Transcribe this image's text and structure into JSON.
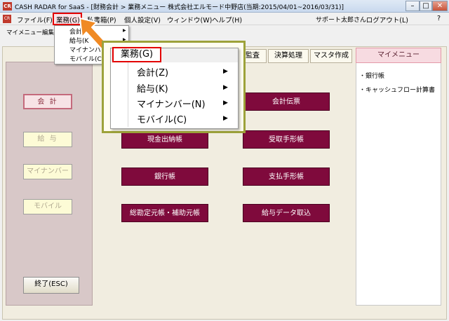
{
  "window": {
    "icon_label": "CR",
    "title": "CASH RADAR for SaaS - [財務会計 > 業務メニュー 株式会社エルモード中野店(当期:2015/04/01~2016/03/31)]",
    "min_label": "–",
    "max_label": "□",
    "close_label": "✕"
  },
  "menubar": {
    "items": [
      "ファイル(F)",
      "業務(G)",
      "私書箱(P)",
      "個人設定(V)",
      "ウィンドウ(W)",
      "ヘルプ(H)"
    ],
    "user": "サポート太郎さん",
    "logout": "ログアウト(L)",
    "help": "?"
  },
  "toolbar": {
    "label": "マイメニュー編集"
  },
  "dropdown": {
    "items": [
      "会計(Z)",
      "給与(K)",
      "マイナンバー(N)",
      "モバイル(C)"
    ],
    "small_items": [
      "会計",
      "給与(K",
      "マイナンバ",
      "モバイル(C"
    ],
    "header": "業務(G)",
    "arrow": "▶"
  },
  "side": {
    "kaikei": "会 計",
    "kyuyo": "給 与",
    "mynumber": "マイナンバー",
    "mobile": "モバイル",
    "exit": "終了(ESC)"
  },
  "tabs": [
    "監査",
    "決算処理",
    "マスタ作成"
  ],
  "content_buttons": [
    "会計伝票",
    "現金出納帳",
    "受取手形帳",
    "銀行帳",
    "支払手形帳",
    "総勘定元帳・補助元帳",
    "給与データ取込"
  ],
  "mymenu": {
    "title": "マイメニュー",
    "items": [
      "・銀行帳",
      "・キャッシュフロー計算書"
    ]
  },
  "colors": {
    "accent_button": "#7f0a3c",
    "highlight_border": "#e30000",
    "callout_arrow": "#f08a24",
    "callout_frame": "#9da23a"
  }
}
